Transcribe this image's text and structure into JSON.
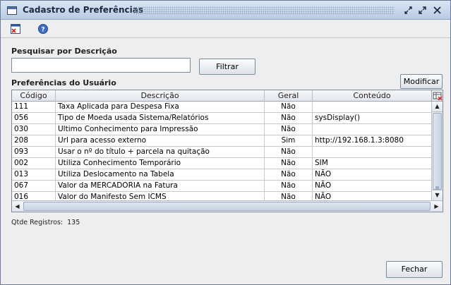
{
  "window": {
    "title": "Cadastro de Preferências",
    "icon": "window-icon",
    "controls": [
      "restore-icon",
      "maximize-icon",
      "close-icon"
    ]
  },
  "toolbar": {
    "icons": [
      "exit-icon",
      "help-icon"
    ]
  },
  "search": {
    "label": "Pesquisar por Descrição",
    "value": "",
    "filter_button": "Filtrar"
  },
  "preferences": {
    "label": "Preferências do Usuário",
    "modify_button": "Modificar"
  },
  "table": {
    "columns": [
      "Código",
      "Descrição",
      "Geral",
      "Conteúdo"
    ],
    "rows": [
      [
        "111",
        "Taxa Aplicada para Despesa Fixa",
        "Não",
        ""
      ],
      [
        "056",
        "Tipo de Moeda usada Sistema/Relatórios",
        "Não",
        "sysDisplay()"
      ],
      [
        "030",
        "Ultimo Conhecimento para Impressão",
        "Não",
        ""
      ],
      [
        "208",
        "Url para acesso externo",
        "Sim",
        "http://192.168.1.3:8080"
      ],
      [
        "093",
        "Usar o nº do título + parcela na quitação",
        "Não",
        ""
      ],
      [
        "002",
        "Utiliza Conhecimento Temporário",
        "Não",
        "SIM"
      ],
      [
        "013",
        "Utiliza Deslocamento na Tabela",
        "Não",
        "NÃO"
      ],
      [
        "067",
        "Valor da MERCADORIA na Fatura",
        "Não",
        "NÃO"
      ],
      [
        "016",
        "Valor do Manifesto Sem ICMS",
        "Não",
        "NÃO"
      ]
    ]
  },
  "footer": {
    "count_label": "Qtde Registros:",
    "count_value": "135",
    "close_button": "Fechar"
  },
  "colors": {
    "title_bar": "#c7d6ea",
    "window_bg": "#eeeeee",
    "border": "#7a8a99"
  }
}
